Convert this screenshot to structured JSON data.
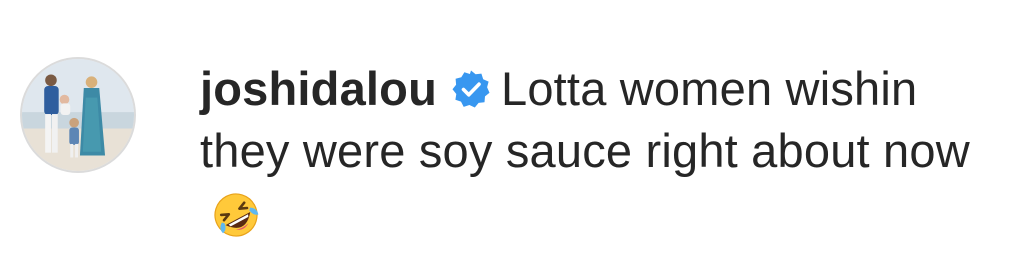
{
  "comment": {
    "username": "joshidalou",
    "verified_icon": "verified-badge-icon",
    "text": "Lotta women wishin they were soy sauce right about now",
    "emoji_icon": "rolling-on-floor-laughing-emoji",
    "colors": {
      "verified_badge": "#3897f0",
      "username": "#262626",
      "text": "#262626"
    }
  },
  "avatar": {
    "icon": "profile-photo-avatar"
  }
}
